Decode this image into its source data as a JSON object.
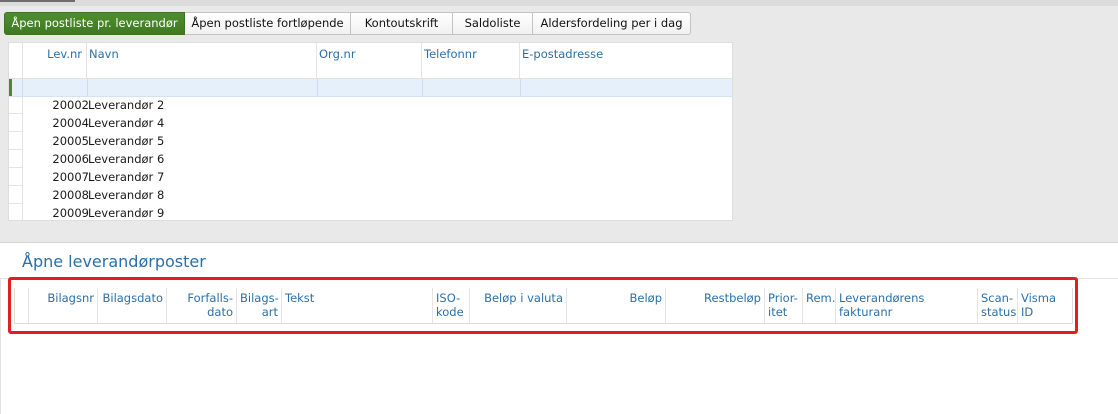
{
  "tabs": [
    {
      "label": "Åpen postliste pr. leverandør",
      "active": true
    },
    {
      "label": "Åpen postliste fortløpende",
      "active": false
    },
    {
      "label": "Kontoutskrift",
      "active": false
    },
    {
      "label": "Saldoliste",
      "active": false
    },
    {
      "label": "Aldersfordeling per i dag",
      "active": false
    }
  ],
  "supplier_grid": {
    "columns": [
      "Lev.nr",
      "Navn",
      "Org.nr",
      "Telefonnr",
      "E-postadresse"
    ],
    "rows": [
      {
        "levnr": "20002",
        "navn": "Leverandør 2"
      },
      {
        "levnr": "20004",
        "navn": "Leverandør 4"
      },
      {
        "levnr": "20005",
        "navn": "Leverandør 5"
      },
      {
        "levnr": "20006",
        "navn": "Leverandør 6"
      },
      {
        "levnr": "20007",
        "navn": "Leverandør 7"
      },
      {
        "levnr": "20008",
        "navn": "Leverandør 8"
      },
      {
        "levnr": "20009",
        "navn": "Leverandør 9"
      }
    ]
  },
  "entries_panel": {
    "title": "Åpne leverandørposter",
    "columns": [
      "Bilagsnr",
      "Bilagsdato",
      "Forfalls-\ndato",
      "Bilags-\nart",
      "Tekst",
      "ISO-\nkode",
      "Beløp i valuta",
      "Beløp",
      "Restbeløp",
      "Prior-\nitet",
      "Rem.",
      "Leverandørens fakturanr",
      "Scan-\nstatus",
      "Visma ID"
    ]
  },
  "colors": {
    "accent": "#3f7a22",
    "header_text": "#2b6fa8",
    "highlight": "#e02020"
  }
}
